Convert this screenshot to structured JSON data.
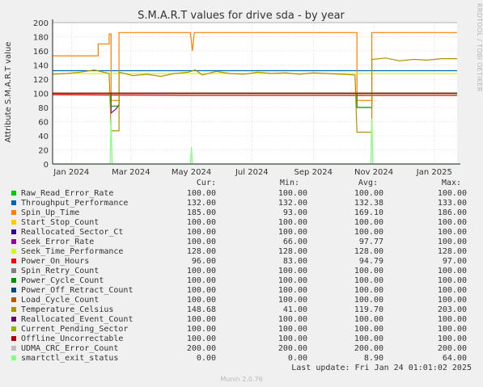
{
  "chart_data": {
    "type": "line",
    "title": "S.M.A.R.T values for drive sda - by year",
    "ylabel": "Attribute S.M.A.R.T value",
    "ylim": [
      0,
      200
    ],
    "y_ticks": [
      0,
      20,
      40,
      60,
      80,
      100,
      120,
      140,
      160,
      180,
      200
    ],
    "x_tick_labels": [
      "Jan 2024",
      "Mar 2024",
      "May 2024",
      "Jul 2024",
      "Sep 2024",
      "Nov 2024",
      "Jan 2025"
    ],
    "x_ticks": [
      "2024-01-01",
      "2024-03-01",
      "2024-05-01",
      "2024-07-01",
      "2024-09-01",
      "2024-11-01",
      "2025-01-01"
    ],
    "x_range": [
      "2023-12-13",
      "2025-01-24"
    ],
    "grid": true,
    "series": [
      {
        "name": "Raw_Read_Error_Rate",
        "color": "#00cc00",
        "points": [
          [
            "2023-12-13",
            100
          ],
          [
            "2025-01-24",
            100
          ]
        ]
      },
      {
        "name": "Throughput_Performance",
        "color": "#0066b3",
        "points": [
          [
            "2023-12-13",
            132
          ],
          [
            "2025-01-24",
            132
          ]
        ]
      },
      {
        "name": "Spin_Up_Time",
        "color": "#ff8000",
        "points": [
          [
            "2023-12-13",
            153
          ],
          [
            "2024-01-28",
            153
          ],
          [
            "2024-01-28",
            170
          ],
          [
            "2024-02-08",
            170
          ],
          [
            "2024-02-08",
            184
          ],
          [
            "2024-02-10",
            184
          ],
          [
            "2024-02-10",
            90
          ],
          [
            "2024-02-18",
            90
          ],
          [
            "2024-02-18",
            186
          ],
          [
            "2024-04-30",
            186
          ],
          [
            "2024-05-02",
            160
          ],
          [
            "2024-05-04",
            186
          ],
          [
            "2024-10-15",
            186
          ],
          [
            "2024-10-15",
            90
          ],
          [
            "2024-10-30",
            90
          ],
          [
            "2024-10-30",
            186
          ],
          [
            "2025-01-24",
            186
          ]
        ]
      },
      {
        "name": "Start_Stop_Count",
        "color": "#ffcc00",
        "points": [
          [
            "2023-12-13",
            100
          ],
          [
            "2025-01-24",
            100
          ]
        ]
      },
      {
        "name": "Reallocated_Sector_Ct",
        "color": "#330099",
        "points": [
          [
            "2023-12-13",
            100
          ],
          [
            "2025-01-24",
            100
          ]
        ]
      },
      {
        "name": "Seek_Error_Rate",
        "color": "#990099",
        "points": [
          [
            "2023-12-13",
            100
          ],
          [
            "2024-02-10",
            100
          ],
          [
            "2024-02-10",
            72
          ],
          [
            "2024-02-15",
            78
          ],
          [
            "2024-02-18",
            84
          ],
          [
            "2024-02-18",
            100
          ],
          [
            "2025-01-24",
            100
          ]
        ]
      },
      {
        "name": "Seek_Time_Performance",
        "color": "#ccff00",
        "points": [
          [
            "2023-12-13",
            128
          ],
          [
            "2025-01-24",
            128
          ]
        ]
      },
      {
        "name": "Power_On_Hours",
        "color": "#ff0000",
        "points": [
          [
            "2023-12-13",
            98
          ],
          [
            "2024-05-01",
            97
          ],
          [
            "2024-10-15",
            97
          ],
          [
            "2025-01-24",
            97
          ]
        ]
      },
      {
        "name": "Spin_Retry_Count",
        "color": "#808080",
        "points": [
          [
            "2023-12-13",
            100
          ],
          [
            "2025-01-24",
            100
          ]
        ]
      },
      {
        "name": "Power_Cycle_Count",
        "color": "#008f00",
        "points": [
          [
            "2023-12-13",
            100
          ],
          [
            "2024-02-10",
            100
          ],
          [
            "2024-02-10",
            82
          ],
          [
            "2024-02-18",
            82
          ],
          [
            "2024-02-18",
            100
          ],
          [
            "2024-10-15",
            100
          ],
          [
            "2024-10-15",
            80
          ],
          [
            "2024-10-30",
            80
          ],
          [
            "2024-10-30",
            100
          ],
          [
            "2025-01-24",
            100
          ]
        ]
      },
      {
        "name": "Power_Off_Retract_Count",
        "color": "#00487d",
        "points": [
          [
            "2023-12-13",
            100
          ],
          [
            "2025-01-24",
            100
          ]
        ]
      },
      {
        "name": "Load_Cycle_Count",
        "color": "#b35a00",
        "points": [
          [
            "2023-12-13",
            100
          ],
          [
            "2025-01-24",
            100
          ]
        ]
      },
      {
        "name": "Temperature_Celsius",
        "color": "#b38f00",
        "points": [
          [
            "2023-12-13",
            127
          ],
          [
            "2023-12-27",
            128
          ],
          [
            "2024-01-10",
            130
          ],
          [
            "2024-01-24",
            133
          ],
          [
            "2024-02-08",
            128
          ],
          [
            "2024-02-10",
            47
          ],
          [
            "2024-02-18",
            47
          ],
          [
            "2024-02-18",
            130
          ],
          [
            "2024-03-03",
            125
          ],
          [
            "2024-03-17",
            127
          ],
          [
            "2024-03-31",
            124
          ],
          [
            "2024-04-14",
            128
          ],
          [
            "2024-04-28",
            130
          ],
          [
            "2024-05-05",
            133
          ],
          [
            "2024-05-12",
            126
          ],
          [
            "2024-05-26",
            131
          ],
          [
            "2024-06-09",
            128
          ],
          [
            "2024-06-23",
            127
          ],
          [
            "2024-07-07",
            130
          ],
          [
            "2024-07-21",
            128
          ],
          [
            "2024-08-04",
            129
          ],
          [
            "2024-08-18",
            127
          ],
          [
            "2024-09-01",
            129
          ],
          [
            "2024-09-15",
            128
          ],
          [
            "2024-09-29",
            127
          ],
          [
            "2024-10-13",
            126
          ],
          [
            "2024-10-15",
            45
          ],
          [
            "2024-10-30",
            45
          ],
          [
            "2024-10-30",
            148
          ],
          [
            "2024-11-13",
            150
          ],
          [
            "2024-11-27",
            146
          ],
          [
            "2024-12-11",
            148
          ],
          [
            "2024-12-25",
            147
          ],
          [
            "2025-01-08",
            149
          ],
          [
            "2025-01-24",
            149
          ]
        ]
      },
      {
        "name": "Reallocated_Event_Count",
        "color": "#6b006b",
        "points": [
          [
            "2023-12-13",
            100
          ],
          [
            "2025-01-24",
            100
          ]
        ]
      },
      {
        "name": "Current_Pending_Sector",
        "color": "#8fb300",
        "points": [
          [
            "2023-12-13",
            100
          ],
          [
            "2025-01-24",
            100
          ]
        ]
      },
      {
        "name": "Offline_Uncorrectable",
        "color": "#b30000",
        "points": [
          [
            "2023-12-13",
            100
          ],
          [
            "2025-01-24",
            100
          ]
        ]
      },
      {
        "name": "UDMA_CRC_Error_Count",
        "color": "#bebebe",
        "points": [
          [
            "2023-12-13",
            200
          ],
          [
            "2025-01-24",
            200
          ]
        ]
      },
      {
        "name": "smartctl_exit_status",
        "color": "#80ff80",
        "points": [
          [
            "2023-12-13",
            0
          ],
          [
            "2024-02-09",
            0
          ],
          [
            "2024-02-10",
            64
          ],
          [
            "2024-02-11",
            0
          ],
          [
            "2024-04-30",
            0
          ],
          [
            "2024-05-01",
            24
          ],
          [
            "2024-05-02",
            0
          ],
          [
            "2024-10-29",
            0
          ],
          [
            "2024-10-30",
            64
          ],
          [
            "2024-10-31",
            0
          ],
          [
            "2025-01-24",
            0
          ]
        ]
      }
    ]
  },
  "legend": {
    "headers": {
      "cur": "Cur:",
      "min": "Min:",
      "avg": "Avg:",
      "max": "Max:"
    },
    "rows": [
      {
        "label": "Raw_Read_Error_Rate",
        "color": "#00cc00",
        "cur": "100.00",
        "min": "100.00",
        "avg": "100.00",
        "max": "100.00"
      },
      {
        "label": "Throughput_Performance",
        "color": "#0066b3",
        "cur": "132.00",
        "min": "132.00",
        "avg": "132.38",
        "max": "133.00"
      },
      {
        "label": "Spin_Up_Time",
        "color": "#ff8000",
        "cur": "185.00",
        "min": "93.00",
        "avg": "169.10",
        "max": "186.00"
      },
      {
        "label": "Start_Stop_Count",
        "color": "#ffcc00",
        "cur": "100.00",
        "min": "100.00",
        "avg": "100.00",
        "max": "100.00"
      },
      {
        "label": "Reallocated_Sector_Ct",
        "color": "#330099",
        "cur": "100.00",
        "min": "100.00",
        "avg": "100.00",
        "max": "100.00"
      },
      {
        "label": "Seek_Error_Rate",
        "color": "#990099",
        "cur": "100.00",
        "min": "66.00",
        "avg": "97.77",
        "max": "100.00"
      },
      {
        "label": "Seek_Time_Performance",
        "color": "#ccff00",
        "cur": "128.00",
        "min": "128.00",
        "avg": "128.00",
        "max": "128.00"
      },
      {
        "label": "Power_On_Hours",
        "color": "#ff0000",
        "cur": "96.00",
        "min": "83.00",
        "avg": "94.79",
        "max": "97.00"
      },
      {
        "label": "Spin_Retry_Count",
        "color": "#808080",
        "cur": "100.00",
        "min": "100.00",
        "avg": "100.00",
        "max": "100.00"
      },
      {
        "label": "Power_Cycle_Count",
        "color": "#008f00",
        "cur": "100.00",
        "min": "100.00",
        "avg": "100.00",
        "max": "100.00"
      },
      {
        "label": "Power_Off_Retract_Count",
        "color": "#00487d",
        "cur": "100.00",
        "min": "100.00",
        "avg": "100.00",
        "max": "100.00"
      },
      {
        "label": "Load_Cycle_Count",
        "color": "#b35a00",
        "cur": "100.00",
        "min": "100.00",
        "avg": "100.00",
        "max": "100.00"
      },
      {
        "label": "Temperature_Celsius",
        "color": "#b38f00",
        "cur": "148.68",
        "min": "41.00",
        "avg": "119.70",
        "max": "203.00"
      },
      {
        "label": "Reallocated_Event_Count",
        "color": "#6b006b",
        "cur": "100.00",
        "min": "100.00",
        "avg": "100.00",
        "max": "100.00"
      },
      {
        "label": "Current_Pending_Sector",
        "color": "#8fb300",
        "cur": "100.00",
        "min": "100.00",
        "avg": "100.00",
        "max": "100.00"
      },
      {
        "label": "Offline_Uncorrectable",
        "color": "#b30000",
        "cur": "100.00",
        "min": "100.00",
        "avg": "100.00",
        "max": "100.00"
      },
      {
        "label": "UDMA_CRC_Error_Count",
        "color": "#bebebe",
        "cur": "200.00",
        "min": "200.00",
        "avg": "200.00",
        "max": "200.00"
      },
      {
        "label": "smartctl_exit_status",
        "color": "#80ff80",
        "cur": "0.00",
        "min": "0.00",
        "avg": "8.90",
        "max": "64.00"
      }
    ]
  },
  "last_update": "Last update: Fri Jan 24 01:01:02 2025",
  "side_label": "RRDTOOL / TOBI OETIKER",
  "footer": "Munin 2.0.76"
}
